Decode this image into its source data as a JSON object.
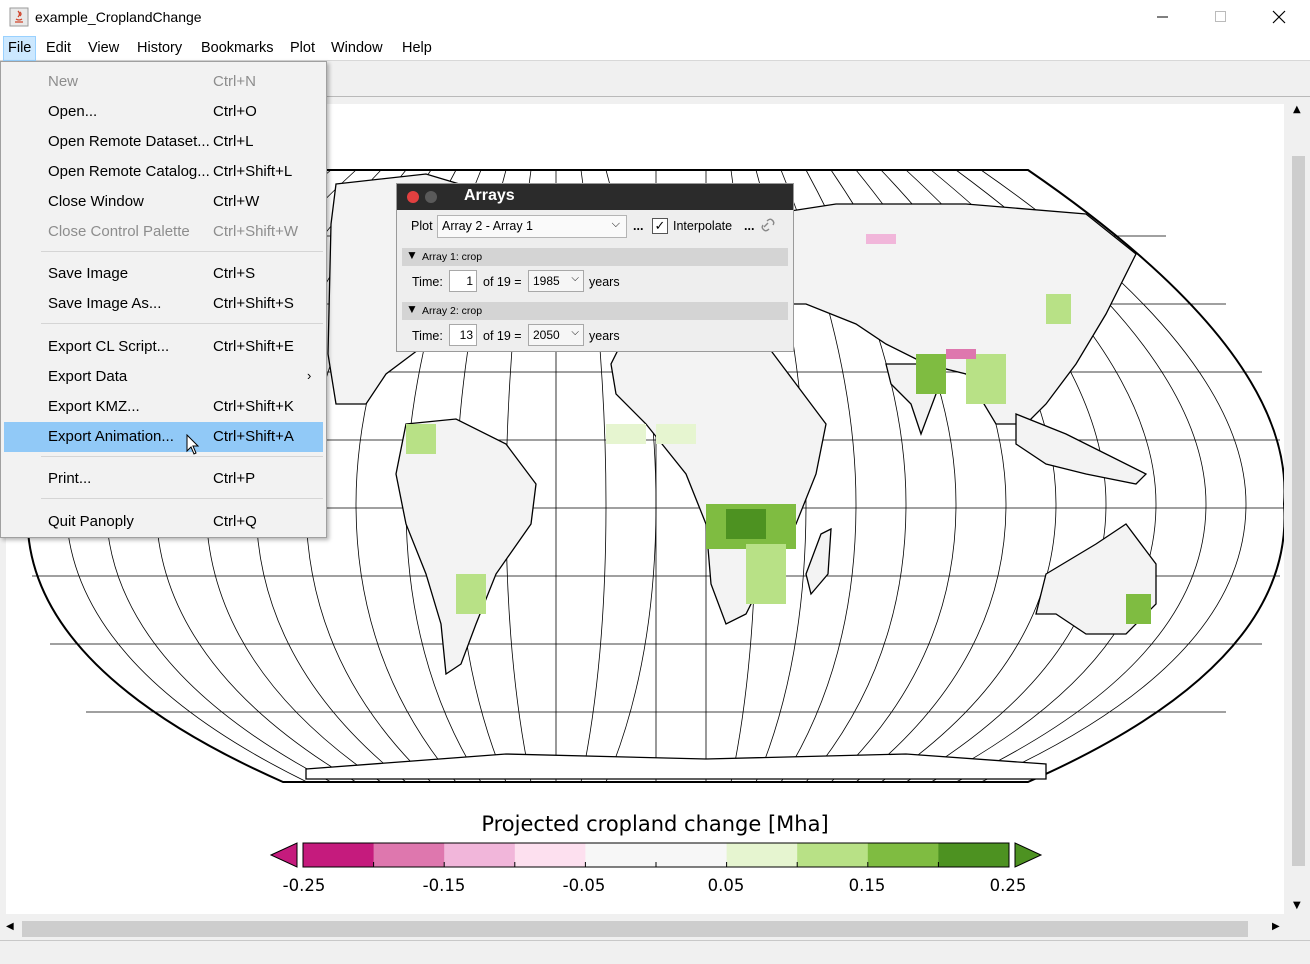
{
  "window": {
    "title": "example_CroplandChange",
    "controls": [
      "minimize",
      "maximize",
      "close"
    ]
  },
  "menubar": {
    "items": [
      "File",
      "Edit",
      "View",
      "History",
      "Bookmarks",
      "Plot",
      "Window",
      "Help"
    ],
    "active": "File"
  },
  "file_menu": {
    "items": [
      {
        "label": "New",
        "shortcut": "Ctrl+N",
        "disabled": true
      },
      {
        "label": "Open...",
        "shortcut": "Ctrl+O"
      },
      {
        "label": "Open Remote Dataset...",
        "shortcut": "Ctrl+L"
      },
      {
        "label": "Open Remote Catalog...",
        "shortcut": "Ctrl+Shift+L"
      },
      {
        "label": "Close Window",
        "shortcut": "Ctrl+W"
      },
      {
        "label": "Close Control Palette",
        "shortcut": "Ctrl+Shift+W",
        "disabled": true
      },
      {
        "label": "Save Image",
        "shortcut": "Ctrl+S"
      },
      {
        "label": "Save Image As...",
        "shortcut": "Ctrl+Shift+S"
      },
      {
        "label": "Export CL Script...",
        "shortcut": "Ctrl+Shift+E"
      },
      {
        "label": "Export Data",
        "shortcut": "",
        "submenu": true
      },
      {
        "label": "Export KMZ...",
        "shortcut": "Ctrl+Shift+K"
      },
      {
        "label": "Export Animation...",
        "shortcut": "Ctrl+Shift+A",
        "highlighted": true
      },
      {
        "label": "Print...",
        "shortcut": "Ctrl+P"
      },
      {
        "label": "Quit Panoply",
        "shortcut": "Ctrl+Q"
      }
    ]
  },
  "arrays_palette": {
    "title": "Arrays",
    "plot_label": "Plot",
    "plot_value": "Array 2 - Array 1",
    "dots": "...",
    "interpolate_label": "Interpolate",
    "interpolate_checked": true,
    "check_mark": "✓",
    "array1": {
      "header": "Array 1: crop",
      "time_label": "Time:",
      "index": "1",
      "of_label": "of 19 =",
      "year": "1985",
      "unit": "years"
    },
    "array2": {
      "header": "Array 2: crop",
      "time_label": "Time:",
      "index": "13",
      "of_label": "of 19 =",
      "year": "2050",
      "unit": "years"
    }
  },
  "colorbar": {
    "title": "Projected cropland change [Mha]",
    "ticks": [
      "-0.25",
      "-0.15",
      "-0.05",
      "0.05",
      "0.15",
      "0.25"
    ],
    "colors": [
      "#c51b7d",
      "#de77ae",
      "#f1b6da",
      "#fde0ef",
      "#f7f7f7",
      "#f7f7f7",
      "#e6f5d0",
      "#b8e186",
      "#7fbc41",
      "#4d9221"
    ],
    "under_color": "#c51b7d",
    "over_color": "#4d9221"
  }
}
